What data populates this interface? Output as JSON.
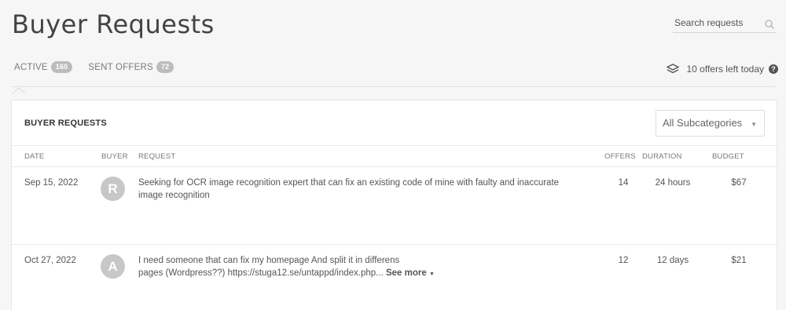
{
  "header": {
    "title": "Buyer Requests",
    "search_placeholder": "Search requests"
  },
  "tabs": [
    {
      "label": "ACTIVE",
      "count": "160"
    },
    {
      "label": "SENT OFFERS",
      "count": "72"
    }
  ],
  "offers_left": {
    "text": "10 offers left today",
    "help": "?"
  },
  "card": {
    "title": "BUYER REQUESTS",
    "subcategory_selected": "All Subcategories",
    "columns": {
      "date": "DATE",
      "buyer": "BUYER",
      "request": "REQUEST",
      "offers": "OFFERS",
      "duration": "DURATION",
      "budget": "BUDGET"
    },
    "rows": [
      {
        "date": "Sep 15, 2022",
        "buyer_initial": "R",
        "request": "Seeking for OCR image recognition expert that can fix an existing code of mine with faulty and inaccurate image recognition",
        "offers": "14",
        "duration": "24 hours",
        "budget": "$67"
      },
      {
        "date": "Oct 27, 2022",
        "buyer_initial": "A",
        "request_line1": "I need someone that can fix my homepage And split it in differens",
        "request_line2": "pages (Wordpress??) https://stuga12.se/untappd/index.php...",
        "see_more": "See more",
        "offers": "12",
        "duration": "12 days",
        "budget": "$21"
      }
    ]
  },
  "icons": {
    "search": "search-icon",
    "stack": "stack-icon",
    "help": "help-icon",
    "caret": "caret-down-icon"
  }
}
